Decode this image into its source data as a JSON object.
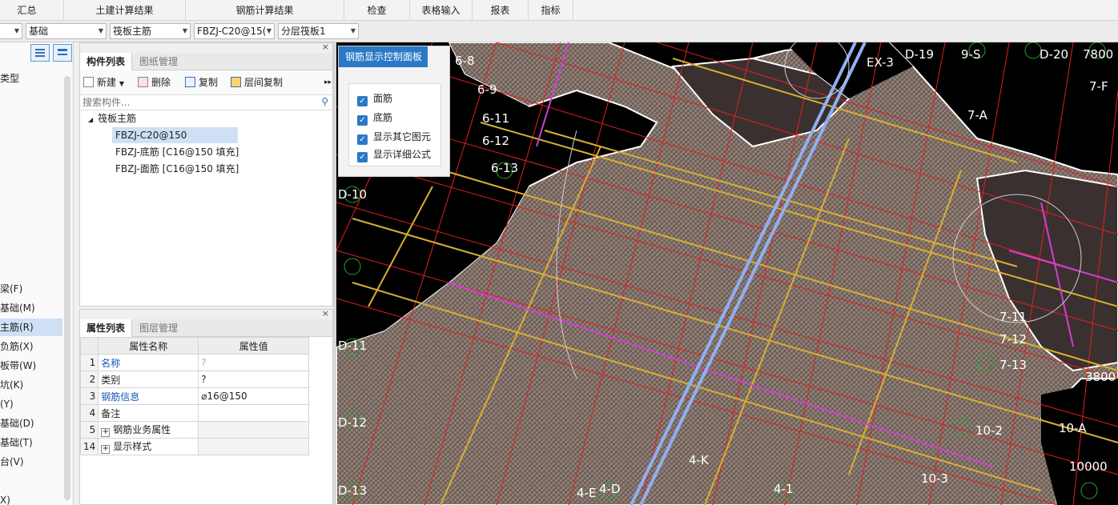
{
  "ribbon": {
    "tabs": [
      "汇总",
      "土建计算结果",
      "钢筋计算结果",
      "检查",
      "表格输入",
      "报表",
      "指标"
    ]
  },
  "selectors": {
    "level": "",
    "category": "基础",
    "type": "筏板主筋",
    "component": "FBZJ-C20@15(",
    "layer": "分层筏板1"
  },
  "left_nav": {
    "header_partial": "类型",
    "items": [
      "梁(F)",
      "基础(M)",
      "主筋(R)",
      "负筋(X)",
      "板带(W)",
      "坑(K)",
      "(Y)",
      "基础(D)",
      "基础(T)",
      "台(V)",
      "",
      "X)"
    ],
    "selected_index": 2
  },
  "component_panel": {
    "tabs": [
      "构件列表",
      "图纸管理"
    ],
    "toolbar": {
      "new": "新建",
      "delete": "删除",
      "copy": "复制",
      "layer_copy": "层间复制"
    },
    "search_placeholder": "搜索构件...",
    "tree_root": "筏板主筋",
    "tree_items": [
      "FBZJ-C20@150",
      "FBZJ-底筋 [C16@150 填充]",
      "FBZJ-面筋 [C16@150 填充]"
    ],
    "selected_item": 0
  },
  "property_panel": {
    "tabs": [
      "属性列表",
      "图层管理"
    ],
    "columns": [
      "属性名称",
      "属性值"
    ],
    "rows": [
      {
        "num": "1",
        "name": "名称",
        "value": "?"
      },
      {
        "num": "2",
        "name": "类别",
        "value": "?"
      },
      {
        "num": "3",
        "name": "钢筋信息",
        "value": "⌀16@150"
      },
      {
        "num": "4",
        "name": "备注",
        "value": ""
      },
      {
        "num": "5",
        "name": "钢筋业务属性",
        "value": ""
      },
      {
        "num": "14",
        "name": "显示样式",
        "value": ""
      }
    ]
  },
  "control_panel": {
    "title": "钢筋显示控制面板",
    "options": [
      {
        "label": "面筋",
        "checked": true
      },
      {
        "label": "底筋",
        "checked": true
      },
      {
        "label": "显示其它图元",
        "checked": true
      },
      {
        "label": "显示详细公式",
        "checked": true
      }
    ]
  },
  "canvas": {
    "labels": [
      "D-19",
      "9-S",
      "D-20",
      "7800",
      "D-10",
      "6-11",
      "6-12",
      "6-13",
      "7-A",
      "7-F",
      "10-2",
      "10-A",
      "10-3",
      "10000",
      "4-K",
      "4-D",
      "4-E",
      "4-1",
      "7-11",
      "7-12",
      "7-13",
      "3800",
      "6-8",
      "6-9",
      "D-11",
      "D-12",
      "D-13",
      "EX-3"
    ]
  }
}
